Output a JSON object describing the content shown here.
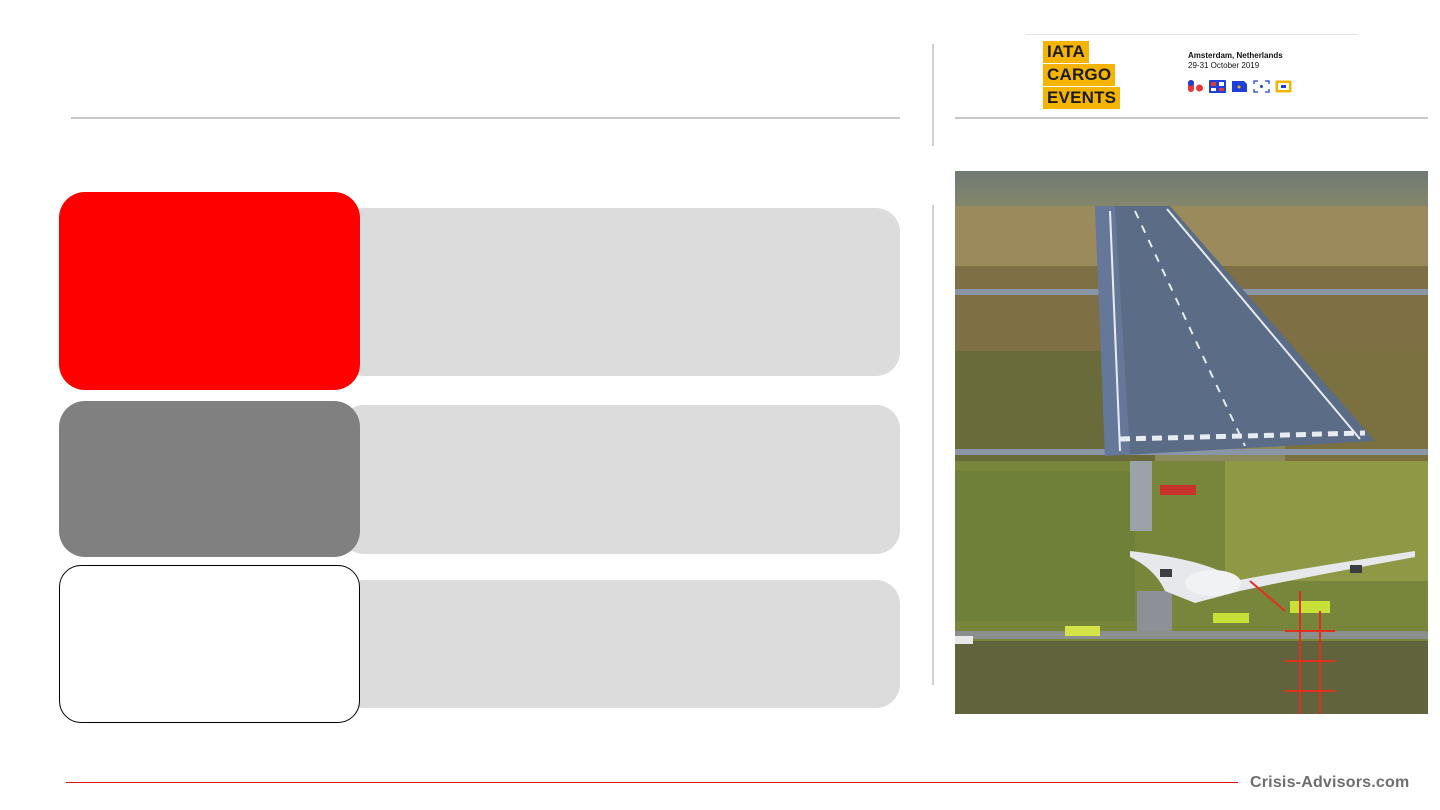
{
  "logo": {
    "lines": [
      "IATA",
      "CARGO",
      "EVENTS"
    ],
    "brand_color": "#f5b400"
  },
  "event": {
    "location": "Amsterdam, Netherlands",
    "dates": "29-31 October 2019",
    "icons": [
      "pharma-icon",
      "medical-icon",
      "document-icon",
      "scan-icon",
      "screen-icon"
    ]
  },
  "cards": [
    {
      "id": "card-1",
      "head_color": "#ff0000"
    },
    {
      "id": "card-2",
      "head_color": "#808080"
    },
    {
      "id": "card-3",
      "head_color": "#ffffff"
    }
  ],
  "photo": {
    "subject": "aerial view of cargo aircraft off runway with emergency vehicles"
  },
  "footer": {
    "brand": "Crisis-Advisors.com",
    "accent": "#e01010"
  }
}
